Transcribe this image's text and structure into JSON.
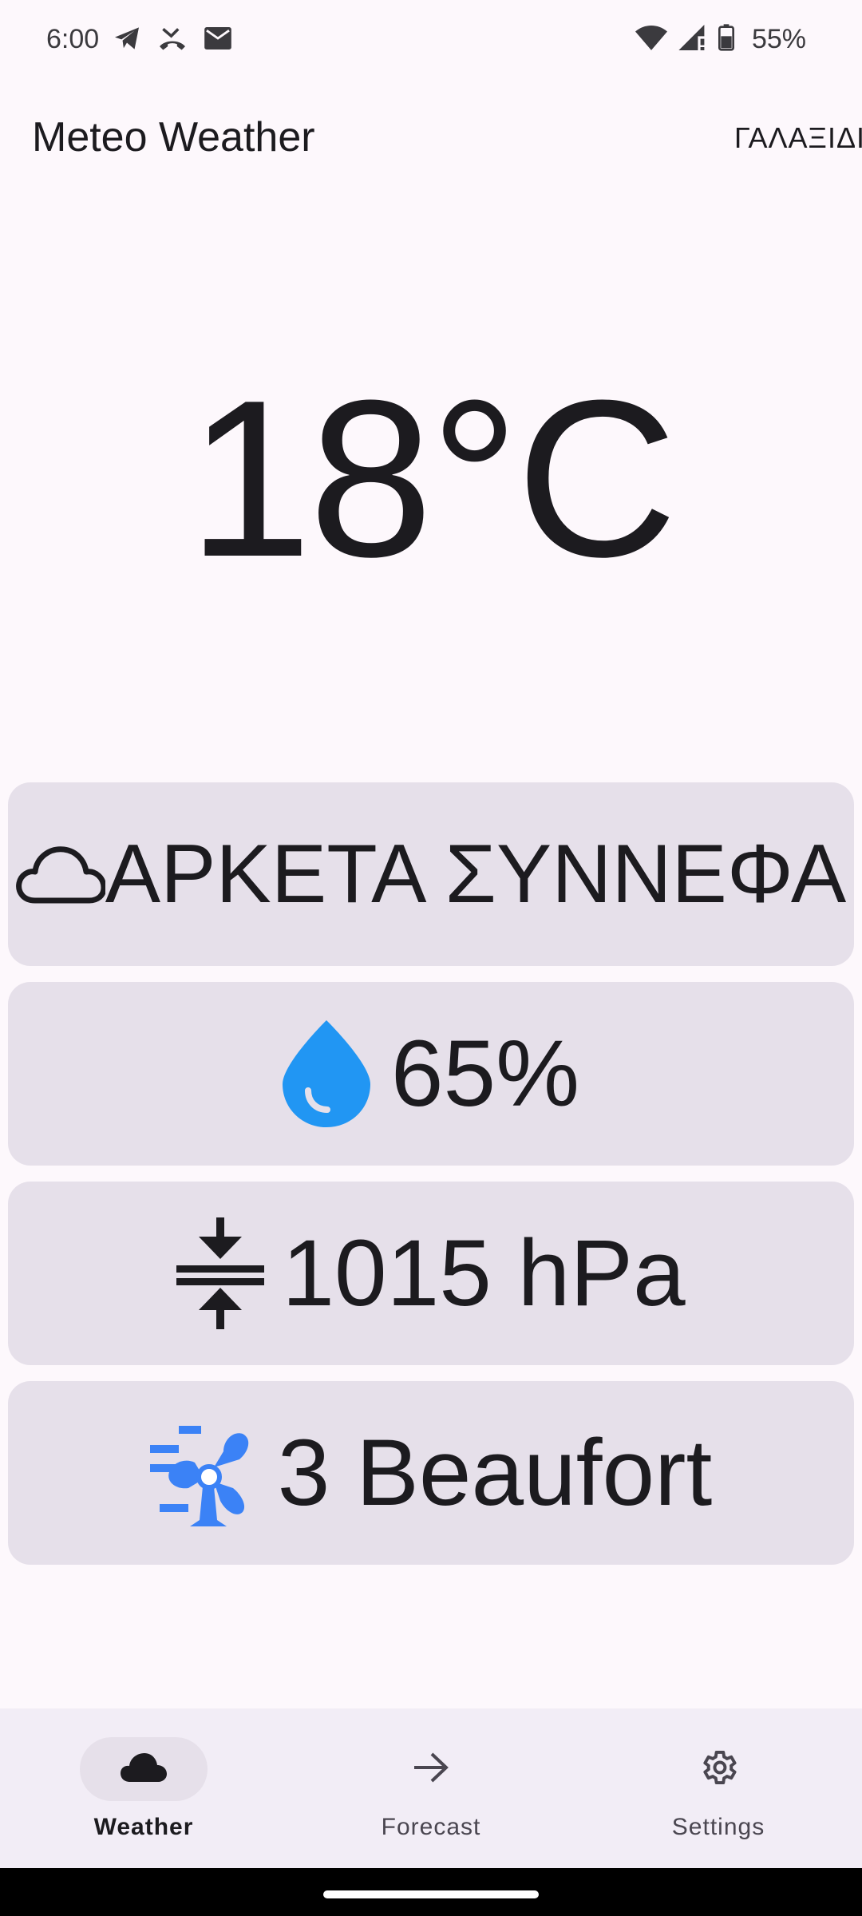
{
  "status_bar": {
    "time": "6:00",
    "battery_percent": "55%",
    "icons_left": [
      "telegram-icon",
      "missed-call-icon",
      "mail-icon"
    ],
    "icons_right": [
      "wifi-icon",
      "signal-icon",
      "battery-icon"
    ]
  },
  "header": {
    "title": "Meteo Weather",
    "location": "ΓΑΛΑΞΙΔΙ"
  },
  "weather": {
    "temperature": "18°C",
    "condition": "ΑΡΚΕΤΑ ΣΥΝΝΕΦΑ",
    "humidity": "65%",
    "pressure": "1015  hPa",
    "wind": "3 Beaufort"
  },
  "icons": {
    "condition": "cloud-icon",
    "humidity": "water-drop-icon",
    "pressure": "compress-icon",
    "wind": "wind-turbine-icon"
  },
  "colors": {
    "accent_blue": "#2196f3",
    "card_bg": "#e6e0ea",
    "background": "#fdf8fc"
  },
  "bottom_nav": {
    "items": [
      {
        "label": "Weather",
        "icon": "cloud-icon",
        "active": true
      },
      {
        "label": "Forecast",
        "icon": "arrow-right-icon",
        "active": false
      },
      {
        "label": "Settings",
        "icon": "gear-icon",
        "active": false
      }
    ]
  }
}
